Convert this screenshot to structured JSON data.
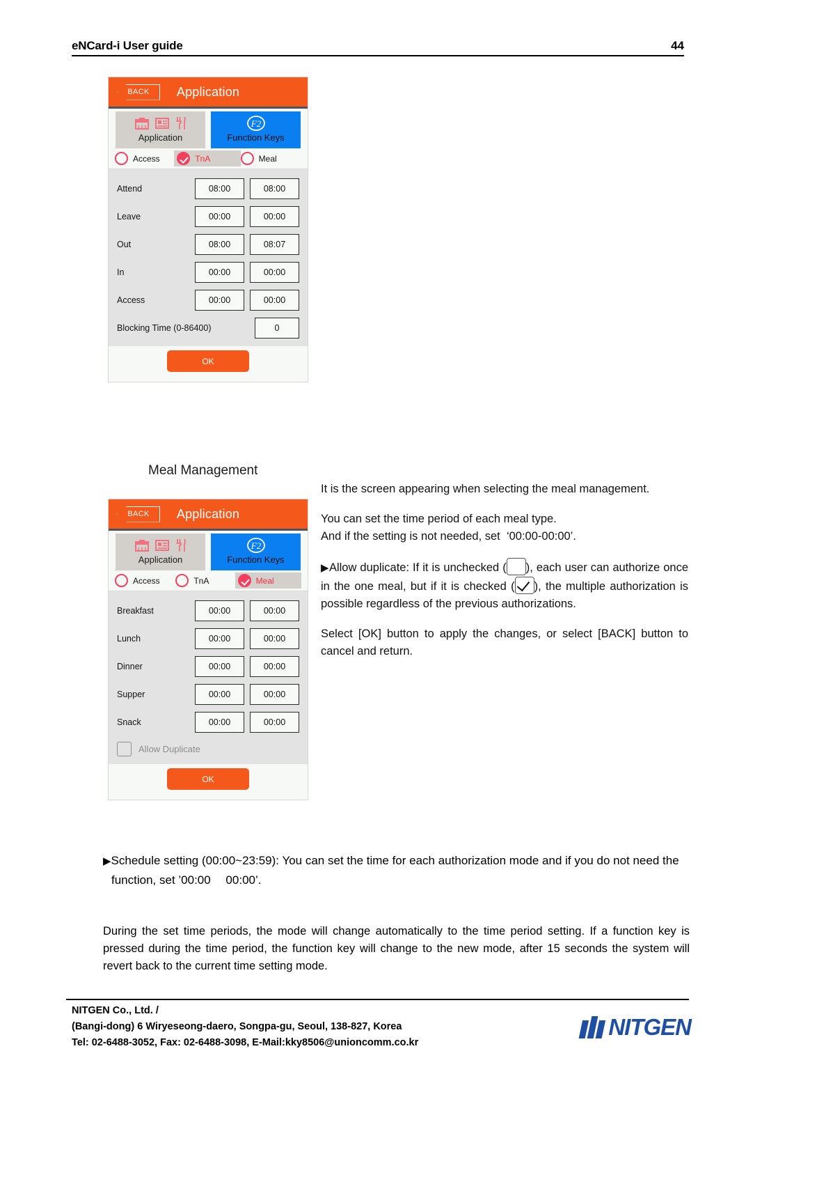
{
  "header": {
    "title": "eNCard-i User guide",
    "page_number": "44"
  },
  "panel_tna": {
    "titlebar": {
      "back_label": "BACK",
      "title": "Application"
    },
    "tabs": [
      {
        "label": "Application",
        "icons": [
          "briefcase-icon",
          "id-card-icon",
          "cutlery-icon"
        ]
      },
      {
        "label": "Function Keys",
        "icons": [
          "f2-icon"
        ],
        "badge": "F2"
      }
    ],
    "radios": [
      {
        "label": "Access",
        "checked": false
      },
      {
        "label": "TnA",
        "checked": true
      },
      {
        "label": "Meal",
        "checked": false
      }
    ],
    "rows": [
      {
        "label": "Attend",
        "start": "08:00",
        "end": "08:00"
      },
      {
        "label": "Leave",
        "start": "00:00",
        "end": "00:00"
      },
      {
        "label": "Out",
        "start": "08:00",
        "end": "08:07"
      },
      {
        "label": "In",
        "start": "00:00",
        "end": "00:00"
      },
      {
        "label": "Access",
        "start": "00:00",
        "end": "00:00"
      }
    ],
    "blocking": {
      "label": "Blocking Time (0-86400)",
      "value": "0"
    },
    "ok_label": "OK"
  },
  "meal_section": {
    "heading": "Meal Management"
  },
  "panel_meal": {
    "titlebar": {
      "back_label": "BACK",
      "title": "Application"
    },
    "tabs": [
      {
        "label": "Application",
        "icons": [
          "briefcase-icon",
          "id-card-icon",
          "cutlery-icon"
        ]
      },
      {
        "label": "Function Keys",
        "icons": [
          "f2-icon"
        ],
        "badge": "F2"
      }
    ],
    "radios": [
      {
        "label": "Access",
        "checked": false
      },
      {
        "label": "TnA",
        "checked": false
      },
      {
        "label": "Meal",
        "checked": true
      }
    ],
    "rows": [
      {
        "label": "Breakfast",
        "start": "00:00",
        "end": "00:00"
      },
      {
        "label": "Lunch",
        "start": "00:00",
        "end": "00:00"
      },
      {
        "label": "Dinner",
        "start": "00:00",
        "end": "00:00"
      },
      {
        "label": "Supper",
        "start": "00:00",
        "end": "00:00"
      },
      {
        "label": "Snack",
        "start": "00:00",
        "end": "00:00"
      }
    ],
    "allow_duplicate": {
      "label": "Allow Duplicate",
      "checked": false
    },
    "ok_label": "OK"
  },
  "body": {
    "p1": "It is the screen appearing when selecting the meal management.",
    "p2_line1": "You can set the time period of each meal type.",
    "p2_line2_a": "And if the setting is not needed, set",
    "p2_line2_b": "‘00:00-00:00’",
    "p2_line2_c": ".",
    "p3_a": "Allow duplicate: If it is unchecked (",
    "p3_b": "), each user can authorize once in the one meal, but if it is checked (",
    "p3_c": "), the multiple authorization is possible regardless of the previous authorizations.",
    "p4": "Select [OK] button to apply the changes, or select [BACK] button to cancel and return.",
    "bullet_marker": "▶"
  },
  "lower_note": {
    "marker": "▶",
    "text": "Schedule setting (00:00~23:59): You can set the time for each authorization mode and if you do not need the function, set ’00:00  00:00’."
  },
  "paragraph": {
    "text": "During the set time periods, the mode will change automatically to the time period setting. If a function key is pressed during the time period, the function key will change to the new mode, after 15 seconds the system will revert back to the current time setting mode."
  },
  "footer": {
    "line1": "NITGEN Co., Ltd. /",
    "line2": "(Bangi-dong) 6 Wiryeseong-daero, Songpa-gu, Seoul, 138-827, Korea",
    "line3": "Tel: 02-6488-3052, Fax: 02-6488-3098, E-Mail:kky8506@unioncomm.co.kr",
    "logo_text": "NITGEN"
  },
  "colors": {
    "orange": "#f4581a",
    "blue": "#0a7ff2",
    "red": "#f43f5e",
    "tab_gray": "#d3d0cb",
    "row_gray": "#e3e3e3",
    "logo_blue": "#1e4fa3"
  }
}
